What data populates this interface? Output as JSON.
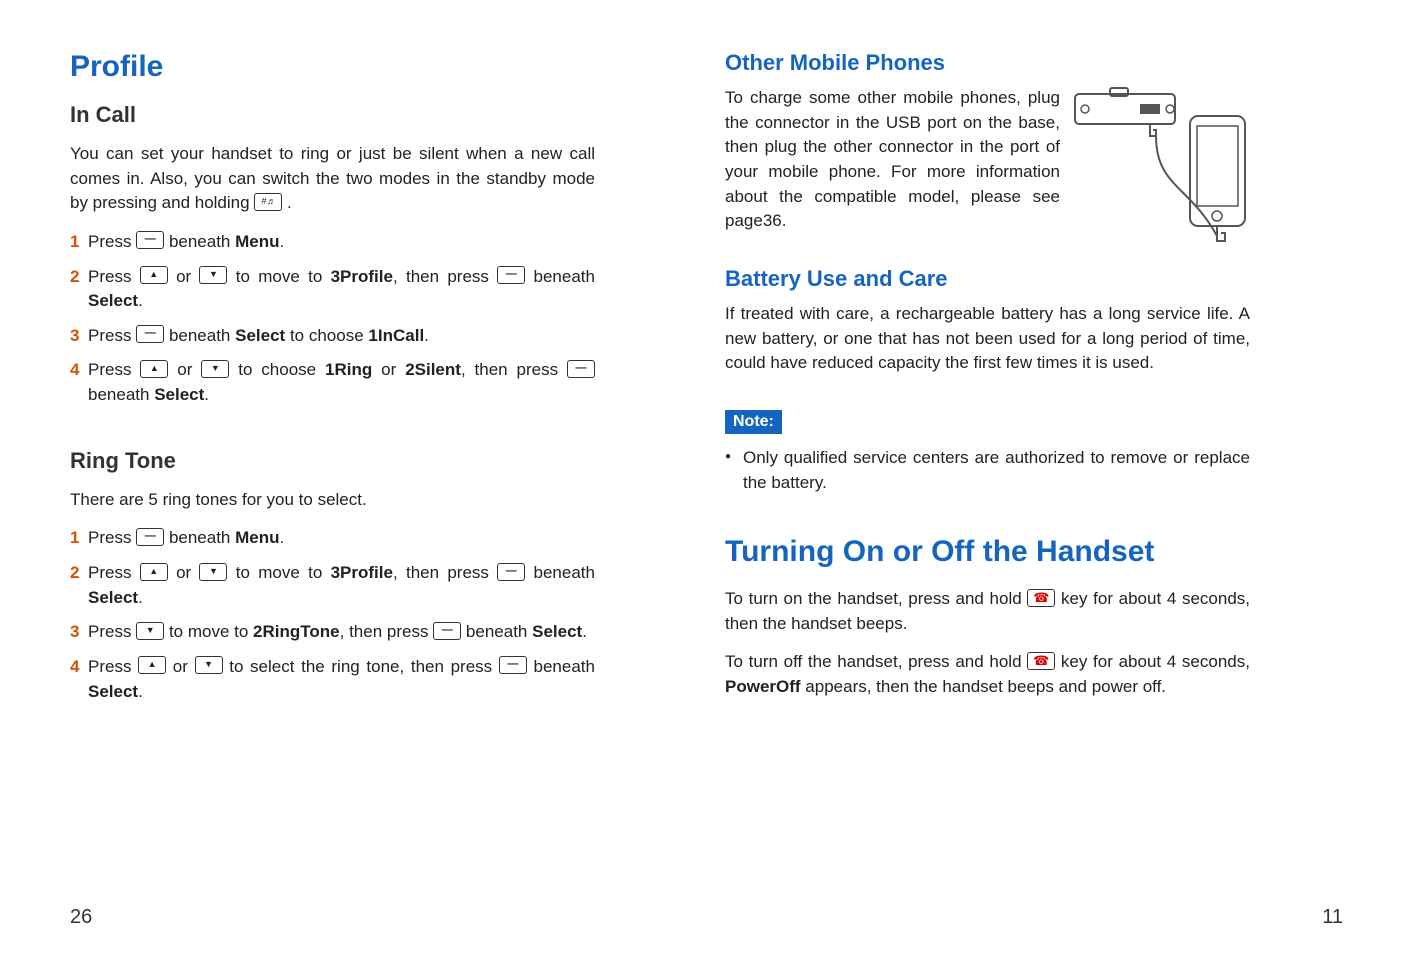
{
  "left": {
    "title": "Profile",
    "inCall": {
      "heading": "In Call",
      "intro": "You can set your handset to ring or just be silent when a new call comes in. Also, you can switch the two modes in the standby mode by pressing and holding",
      "steps": {
        "s1_a": "Press",
        "s1_b": "beneath",
        "s1_menu": "Menu",
        "s2_a": "Press",
        "s2_b": "or",
        "s2_c": "to move to",
        "s2_prof": "3Profile",
        "s2_d": ", then press",
        "s2_e": "beneath",
        "s2_sel": "Select",
        "s3_a": "Press",
        "s3_b": "beneath",
        "s3_sel": "Select",
        "s3_c": "to choose",
        "s3_incall": "1InCall",
        "s4_a": "Press",
        "s4_b": "or",
        "s4_c": "to choose",
        "s4_ring": "1Ring",
        "s4_d": "or",
        "s4_silent": "2Silent",
        "s4_e": ", then press",
        "s4_f": "beneath",
        "s4_sel": "Select"
      }
    },
    "ringTone": {
      "heading": "Ring Tone",
      "intro": "There are 5 ring tones for you to select.",
      "steps": {
        "s1_a": "Press",
        "s1_b": "beneath",
        "s1_menu": "Menu",
        "s2_a": "Press",
        "s2_b": "or",
        "s2_c": "to move to",
        "s2_prof": "3Profile",
        "s2_d": ", then press",
        "s2_e": "beneath",
        "s2_sel": "Select",
        "s3_a": "Press",
        "s3_b": "to move to",
        "s3_rt": "2RingTone",
        "s3_c": ", then press",
        "s3_d": "beneath",
        "s3_sel": "Select",
        "s4_a": "Press",
        "s4_b": "or",
        "s4_c": "to select the ring tone, then press",
        "s4_d": "beneath",
        "s4_sel": "Select"
      }
    },
    "pageNum": "26"
  },
  "right": {
    "otherMobile": {
      "heading": "Other Mobile Phones",
      "body": "To charge some other mobile phones, plug the connector in the USB port on the base, then plug the other connector in the port of your mobile phone. For more information about the compatible model, please see page36."
    },
    "battery": {
      "heading": "Battery Use and Care",
      "body": "If treated with care, a rechargeable battery has a long service life. A new battery, or one that has not been used for a long period of time, could have reduced capacity the first few times it is used.",
      "noteLabel": "Note:",
      "noteItem": "Only qualified service centers are authorized to remove or replace the battery."
    },
    "turning": {
      "heading": "Turning On or Off the Handset",
      "p1a": "To turn on the handset, press and hold",
      "p1b": "key for about 4 seconds, then the handset beeps.",
      "p2a": "To turn off the handset, press and hold",
      "p2b": "key for about 4 seconds,",
      "p2pow": "PowerOff",
      "p2c": "appears, then the handset beeps and power off."
    },
    "pageNum": "11"
  },
  "stepNums": {
    "n1": "1",
    "n2": "2",
    "n3": "3",
    "n4": "4"
  },
  "period": "."
}
